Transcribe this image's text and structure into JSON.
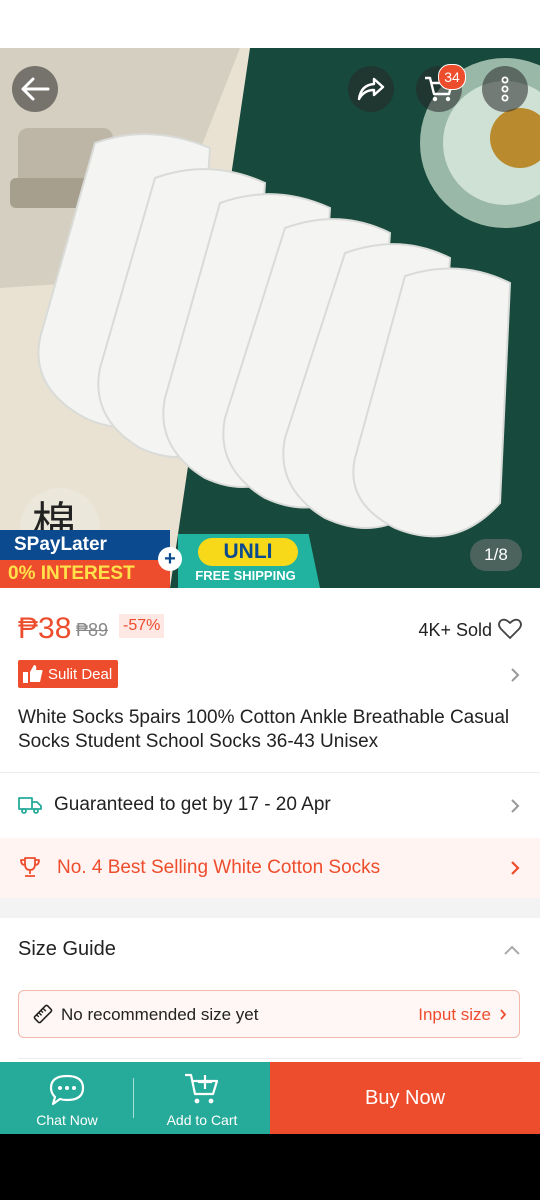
{
  "hero": {
    "cart_count": "34",
    "image_counter": "1/8",
    "watermark_char": "棉",
    "banner": {
      "spaylater": "SPayLater",
      "interest": "0% INTEREST",
      "unli": "UNLI",
      "free_shipping": "FREE SHIPPING"
    }
  },
  "product": {
    "price": "₱38",
    "original_price": "₱89",
    "discount": "-57%",
    "sold": "4K+ Sold",
    "deal_label": "Sulit Deal",
    "title": "White Socks 5pairs 100% Cotton Ankle Breathable Casual Socks Student School Socks 36-43 Unisex"
  },
  "shipping": {
    "text": "Guaranteed to get by 17 - 20 Apr"
  },
  "best_selling": {
    "text": "No. 4 Best Selling White Cotton Socks"
  },
  "size_guide": {
    "title": "Size Guide",
    "recommendation": "No recommended size yet",
    "input_label": "Input size"
  },
  "bottom_bar": {
    "chat_label": "Chat Now",
    "cart_label": "Add to Cart",
    "buy_label": "Buy Now"
  },
  "colors": {
    "brand": "#ee4d2d",
    "teal": "#26aa99",
    "hero_bg": "#17493c"
  }
}
